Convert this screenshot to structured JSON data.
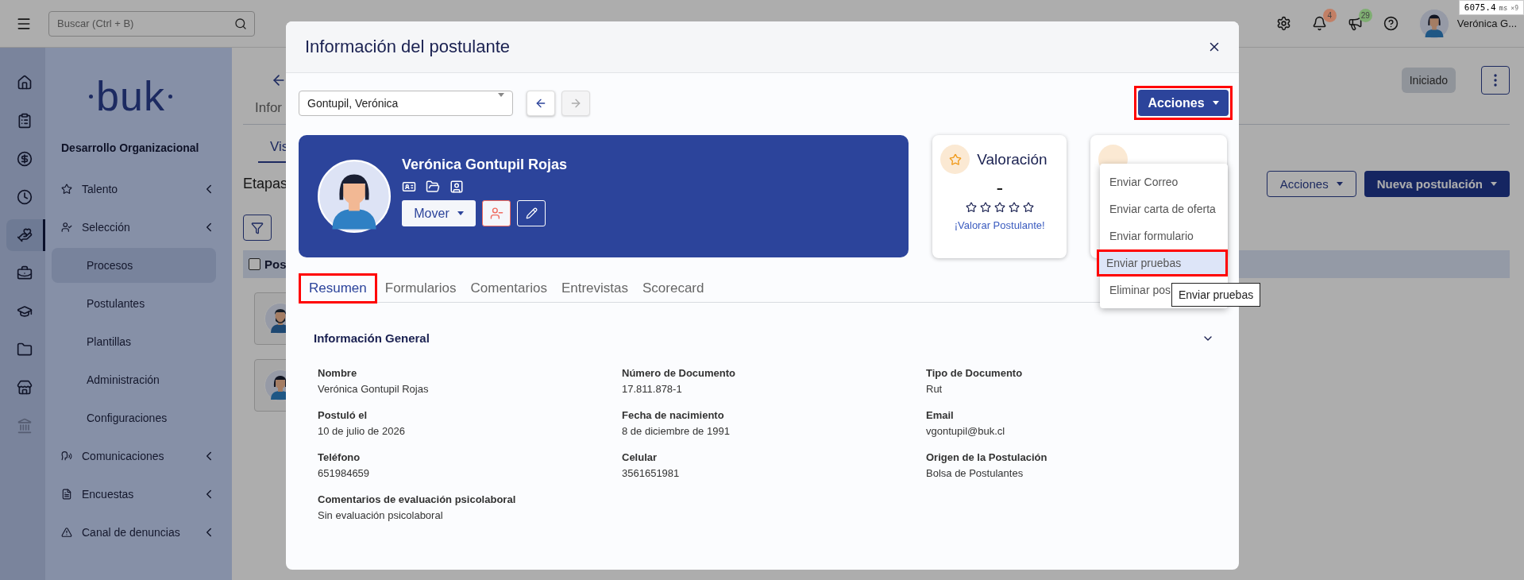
{
  "perf_badge": {
    "value": "6075.4",
    "unit": "ms",
    "count": "×9"
  },
  "topbar": {
    "search": {
      "placeholder": "Buscar (Ctrl + B)"
    },
    "notifications": [
      {
        "count": "4",
        "color": "#c27f65"
      },
      {
        "count": "29",
        "color": "#7fae72"
      }
    ],
    "user": {
      "name": "Verónica G..."
    }
  },
  "rail": [
    {
      "selected": false,
      "disabled": false
    },
    {
      "selected": false,
      "disabled": false
    },
    {
      "selected": false,
      "disabled": false
    },
    {
      "selected": false,
      "disabled": false
    },
    {
      "selected": true,
      "disabled": false
    },
    {
      "selected": false,
      "disabled": false
    },
    {
      "selected": false,
      "disabled": false
    },
    {
      "selected": false,
      "disabled": false
    },
    {
      "selected": false,
      "disabled": false
    },
    {
      "selected": false,
      "disabled": true
    }
  ],
  "sidebar": {
    "logo": "buk",
    "title": "Desarrollo Organizacional",
    "items": [
      {
        "label": "Talento"
      },
      {
        "label": "Selección",
        "children": [
          {
            "label": "Procesos",
            "selected": true
          },
          {
            "label": "Postulantes",
            "selected": false
          },
          {
            "label": "Plantillas",
            "selected": false
          },
          {
            "label": "Administración",
            "selected": false
          },
          {
            "label": "Configuraciones",
            "selected": false
          }
        ]
      },
      {
        "label": "Comunicaciones"
      },
      {
        "label": "Encuestas"
      },
      {
        "label": "Canal de denuncias"
      }
    ]
  },
  "main": {
    "status": "Iniciado",
    "tab": "Infor",
    "subtab": "Vis",
    "section_title": "Etapas",
    "actions_button": "Acciones",
    "new_button": "Nueva postulación",
    "table_header": "Pos",
    "select_all_checked": false,
    "cards": [
      {
        "kind": "man"
      },
      {
        "kind": "woman"
      }
    ]
  },
  "modal": {
    "title": "Información del postulante",
    "candidate_select": "Gontupil, Verónica",
    "nav_buttons": [
      {
        "disabled": false
      },
      {
        "disabled": true
      }
    ],
    "actions_button": {
      "label": "Acciones",
      "highlighted": true
    },
    "menu": [
      {
        "label": "Enviar Correo",
        "selected": false,
        "highlighted": false
      },
      {
        "label": "Enviar carta de oferta",
        "selected": false,
        "highlighted": false
      },
      {
        "label": "Enviar formulario",
        "selected": false,
        "highlighted": false
      },
      {
        "label": "Enviar pruebas",
        "selected": true,
        "highlighted": true
      },
      {
        "label": "Eliminar pos",
        "selected": false,
        "highlighted": false
      }
    ],
    "tooltip": "Enviar pruebas",
    "profile": {
      "name": "Verónica Gontupil Rojas",
      "move_button": "Mover"
    },
    "rating_card": {
      "title": "Valoración",
      "value": "-",
      "stars": 0,
      "link": "¡Valorar Postulante!"
    },
    "tabs": [
      {
        "label": "Resumen",
        "selected": true,
        "highlighted": true
      },
      {
        "label": "Formularios",
        "selected": false,
        "highlighted": false
      },
      {
        "label": "Comentarios",
        "selected": false,
        "highlighted": false
      },
      {
        "label": "Entrevistas",
        "selected": false,
        "highlighted": false
      },
      {
        "label": "Scorecard",
        "selected": false,
        "highlighted": false
      }
    ],
    "section": {
      "title": "Información General",
      "expanded": true,
      "fields": [
        {
          "label": "Nombre",
          "value": "Verónica Gontupil Rojas"
        },
        {
          "label": "Número de Documento",
          "value": "17.811.878-1"
        },
        {
          "label": "Tipo de Documento",
          "value": "Rut"
        },
        {
          "label": "Postuló el",
          "value": "10 de julio de 2026"
        },
        {
          "label": "Fecha de nacimiento",
          "value": "8 de diciembre de 1991"
        },
        {
          "label": "Email",
          "value": "vgontupil@buk.cl"
        },
        {
          "label": "Teléfono",
          "value": "651984659"
        },
        {
          "label": "Celular",
          "value": "3561651981"
        },
        {
          "label": "Origen de la Postulación",
          "value": "Bolsa de Postulantes"
        },
        {
          "label": "Comentarios de evaluación psicolaboral",
          "value": "Sin evaluación psicolaboral"
        }
      ]
    }
  }
}
